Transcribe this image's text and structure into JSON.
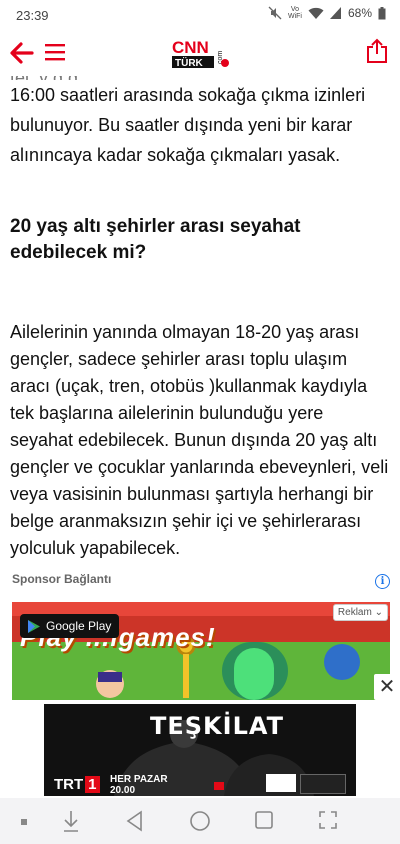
{
  "status": {
    "time": "23:39",
    "volte_line1": "Vo",
    "volte_line2": "WiFi",
    "battery": "68%"
  },
  "header": {
    "logo_top": "CNN",
    "logo_bottom": "TÜRK",
    "logo_suffix": "com",
    "brand_color": "#e4001b"
  },
  "article": {
    "clipped_line": "tel.      y        ğ             g",
    "p1": "16:00 saatleri arasında sokağa çıkma izinleri bulunuyor. Bu saatler dışında yeni bir karar alınıncaya kadar sokağa çıkmaları yasak.",
    "heading": "20 yaş altı şehirler arası seyahat edebilecek mi?",
    "p2": "Ailelerinin yanında olmayan 18-20 yaş arası gençler, sadece şehirler arası toplu ulaşım aracı (uçak, tren, otobüs )kullanmak kaydıyla tek başlarına ailelerinin bulunduğu yere seyahat edebilecek. Bunun dışında 20 yaş altı gençler ve çocuklar yanlarında ebeveynleri, veli veya vasisinin bulunması şartıyla herhangi bir belge aranmaksızın şehir içi ve şehirlerarası yolculuk yapabilecek."
  },
  "ads": {
    "sponsor_label": "Sponsor Bağlantı",
    "info_glyph": "i",
    "google_play": "Google Play",
    "reklam": "Reklam",
    "play_games": "Play ...igames!",
    "close_glyph": "✕",
    "banner_title": "TEŞKİLAT",
    "banner_channel": "TRT",
    "banner_channel_num": "1",
    "banner_day": "HER PAZAR",
    "banner_hour": "20.00"
  },
  "icons": {
    "back": "arrow-left-icon",
    "menu": "hamburger-icon",
    "share": "share-icon"
  }
}
